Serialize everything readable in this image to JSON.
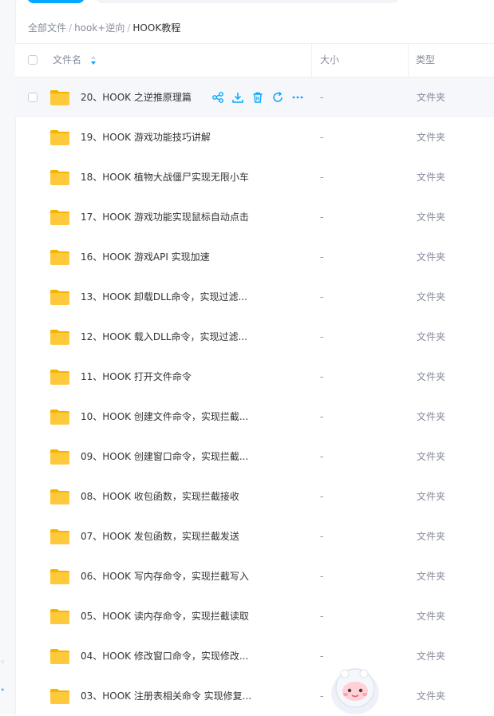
{
  "breadcrumb": {
    "root": "全部文件",
    "parent": "hook+逆向",
    "current": "HOOK教程",
    "separator": "/"
  },
  "table": {
    "headers": {
      "name": "文件名",
      "size": "大小",
      "type": "类型"
    },
    "rows": [
      {
        "name": "20、HOOK 之逆推原理篇",
        "size": "-",
        "type": "文件夹"
      },
      {
        "name": "19、HOOK 游戏功能技巧讲解",
        "size": "-",
        "type": "文件夹"
      },
      {
        "name": "18、HOOK 植物大战僵尸实现无限小车",
        "size": "-",
        "type": "文件夹"
      },
      {
        "name": "17、HOOK 游戏功能实现鼠标自动点击",
        "size": "-",
        "type": "文件夹"
      },
      {
        "name": "16、HOOK 游戏API 实现加速",
        "size": "-",
        "type": "文件夹"
      },
      {
        "name": "13、HOOK 卸载DLL命令，实现过滤...",
        "size": "-",
        "type": "文件夹"
      },
      {
        "name": "12、HOOK 载入DLL命令，实现过滤...",
        "size": "-",
        "type": "文件夹"
      },
      {
        "name": "11、HOOK 打开文件命令",
        "size": "-",
        "type": "文件夹"
      },
      {
        "name": "10、HOOK 创建文件命令，实现拦截...",
        "size": "-",
        "type": "文件夹"
      },
      {
        "name": "09、HOOK 创建窗口命令，实现拦截...",
        "size": "-",
        "type": "文件夹"
      },
      {
        "name": "08、HOOK 收包函数，实现拦截接收",
        "size": "-",
        "type": "文件夹"
      },
      {
        "name": "07、HOOK 发包函数，实现拦截发送",
        "size": "-",
        "type": "文件夹"
      },
      {
        "name": "06、HOOK 写内存命令，实现拦截写入",
        "size": "-",
        "type": "文件夹"
      },
      {
        "name": "05、HOOK 读内存命令，实现拦截读取",
        "size": "-",
        "type": "文件夹"
      },
      {
        "name": "04、HOOK 修改窗口命令，实现修改...",
        "size": "-",
        "type": "文件夹"
      },
      {
        "name": "03、HOOK 注册表相关命令 实现修复...",
        "size": "-",
        "type": "文件夹"
      }
    ],
    "hovered_row_actions": [
      "share-icon",
      "download-icon",
      "delete-icon",
      "refresh-icon",
      "more-icon"
    ]
  },
  "colors": {
    "accent": "#06a7ff",
    "folder": "#ffc93c",
    "hover_row": "#f5f7fb",
    "muted_text": "#878c9c"
  }
}
